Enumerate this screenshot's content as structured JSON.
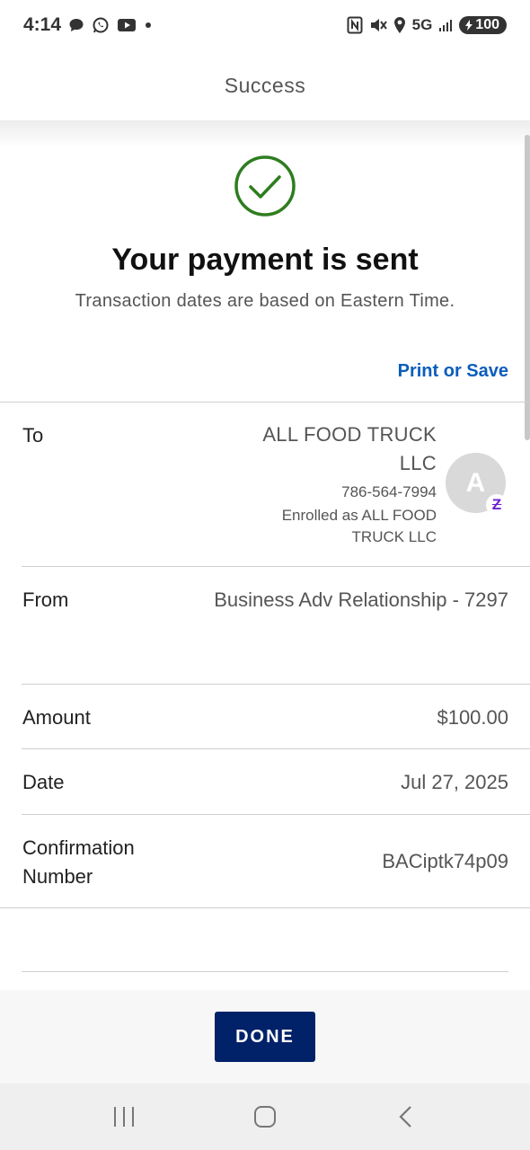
{
  "status_bar": {
    "time": "4:14",
    "network": "5G",
    "battery": "100",
    "left_icons": [
      "chat-icon",
      "whatsapp-icon",
      "youtube-icon",
      "dot-icon"
    ],
    "right_icons": [
      "nfc-icon",
      "mute-icon",
      "location-icon",
      "signal-icon",
      "battery-icon"
    ]
  },
  "header": {
    "title": "Success"
  },
  "confirmation": {
    "headline": "Your payment is sent",
    "subline": "Transaction dates are based on Eastern Time.",
    "print_link": "Print or Save",
    "check_color": "#2e7d1f"
  },
  "details": {
    "to": {
      "label": "To",
      "name": "ALL FOOD TRUCK LLC",
      "phone": "786-564-7994",
      "enrolled": "Enrolled as ALL FOOD TRUCK LLC",
      "avatar_letter": "A",
      "badge": "Z"
    },
    "from": {
      "label": "From",
      "value": "Business Adv Relationship - 7297"
    },
    "amount": {
      "label": "Amount",
      "value": "$100.00"
    },
    "date": {
      "label": "Date",
      "value": "Jul 27, 2025"
    },
    "confirmation_number": {
      "label": "Confirmation Number",
      "value": "BACiptk74p09"
    }
  },
  "actions": {
    "done_label": "DONE",
    "done_color": "#012169"
  },
  "nav_bar": {
    "buttons": [
      "recent-apps-icon",
      "home-icon",
      "back-icon"
    ]
  }
}
